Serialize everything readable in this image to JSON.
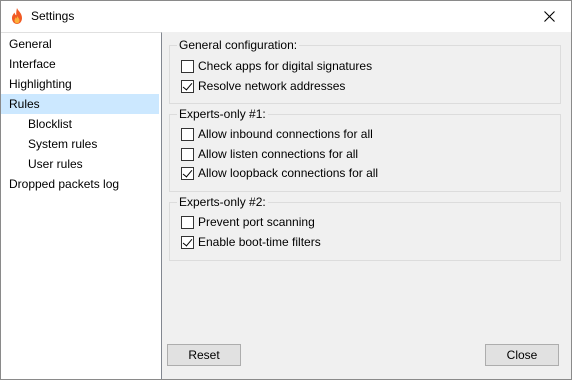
{
  "window": {
    "title": "Settings"
  },
  "sidebar": {
    "items": [
      {
        "label": "General"
      },
      {
        "label": "Interface"
      },
      {
        "label": "Highlighting"
      },
      {
        "label": "Rules",
        "selected": true
      },
      {
        "label": "Blocklist"
      },
      {
        "label": "System rules"
      },
      {
        "label": "User rules"
      },
      {
        "label": "Dropped packets log"
      }
    ]
  },
  "groups": {
    "general": {
      "title": "General configuration:",
      "options": [
        {
          "label": "Check apps for digital signatures",
          "checked": false
        },
        {
          "label": "Resolve network addresses",
          "checked": true
        }
      ]
    },
    "experts1": {
      "title": "Experts-only #1:",
      "options": [
        {
          "label": "Allow inbound connections for all",
          "checked": false
        },
        {
          "label": "Allow listen connections for all",
          "checked": false
        },
        {
          "label": "Allow loopback connections for all",
          "checked": true
        }
      ]
    },
    "experts2": {
      "title": "Experts-only #2:",
      "options": [
        {
          "label": "Prevent port scanning",
          "checked": false
        },
        {
          "label": "Enable boot-time filters",
          "checked": true
        }
      ]
    }
  },
  "buttons": {
    "reset": "Reset",
    "close": "Close"
  },
  "colors": {
    "selection": "#cce8ff",
    "flame_outer": "#f15a24",
    "flame_inner": "#fbb03b"
  }
}
